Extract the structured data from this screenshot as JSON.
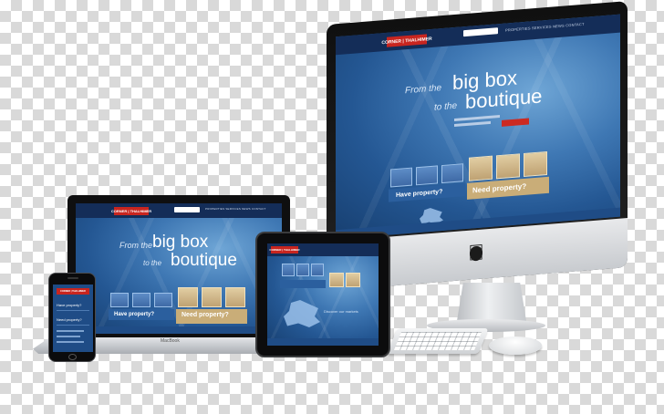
{
  "site": {
    "logo_red": "CORNER",
    "logo_white": "THALHIMER",
    "nav_links": "PROPERTIES  SERVICES  NEWS  CONTACT",
    "headline_small_1": "From the",
    "headline_big_1": "big box",
    "headline_small_2": "to the",
    "headline_big_2": "boutique",
    "cta_have": "Have property?",
    "cta_need": "Need property?",
    "phone_nav_1": "Have property?",
    "phone_nav_2": "Need property?",
    "tablet_text": "Discover our markets"
  },
  "devices": {
    "laptop_brand": "MacBook",
    "imac_logo_icon": "apple-logo-icon"
  },
  "colors": {
    "site_blue": "#245793",
    "nav_navy": "#142d58",
    "logo_red": "#c8251f",
    "tile_tan": "#d6bd8c"
  }
}
